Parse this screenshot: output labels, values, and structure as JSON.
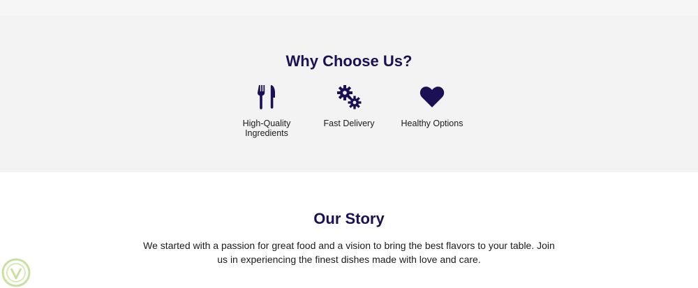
{
  "why_section": {
    "title": "Why Choose Us?",
    "features": [
      {
        "icon": "utensils-icon",
        "label": "High-Quality Ingredients"
      },
      {
        "icon": "cogs-icon",
        "label": "Fast Delivery"
      },
      {
        "icon": "heart-icon",
        "label": "Healthy Options"
      }
    ]
  },
  "story_section": {
    "title": "Our Story",
    "text": "We started with a passion for great food and a vision to bring the best flavors to your table. Join us in experiencing the finest dishes made with love and care."
  },
  "colors": {
    "accent": "#1b0f56",
    "section_bg": "#f3f3f3",
    "badge": "#c8e0a0"
  }
}
